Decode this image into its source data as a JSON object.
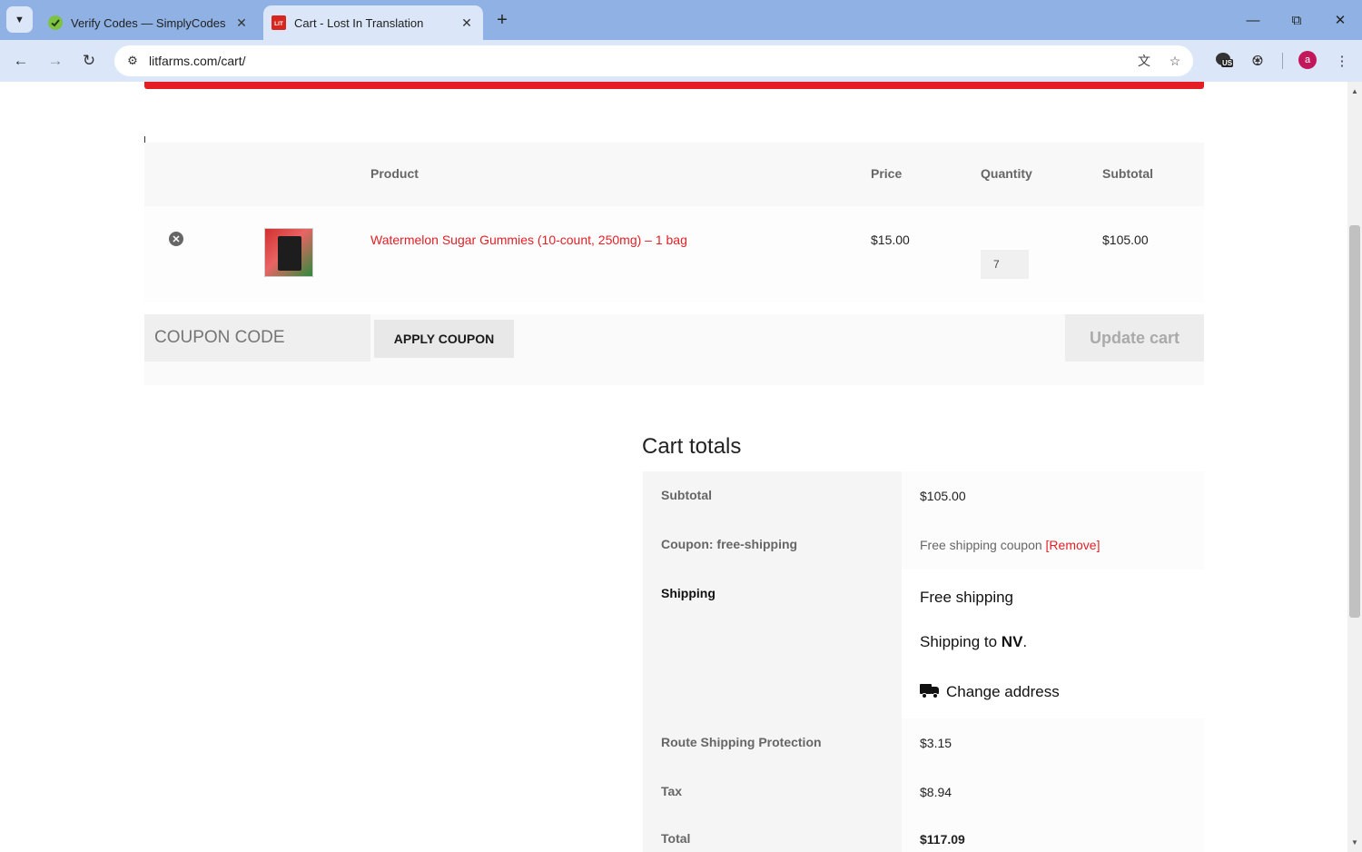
{
  "browser": {
    "tabs": [
      {
        "title": "Verify Codes — SimplyCodes",
        "favicon": "simplycodes-icon",
        "active": false
      },
      {
        "title": "Cart - Lost In Translation",
        "favicon": "litfarms-icon",
        "active": true
      }
    ],
    "favicon_text": "LIT",
    "url": "litfarms.com/cart/",
    "profile_initial": "a",
    "extension_badge": "US"
  },
  "cart": {
    "headers": {
      "product": "Product",
      "price": "Price",
      "quantity": "Quantity",
      "subtotal": "Subtotal"
    },
    "items": [
      {
        "name": "Watermelon Sugar Gummies (10-count, 250mg) – 1 bag",
        "price": "$15.00",
        "quantity": "7",
        "subtotal": "$105.00"
      }
    ],
    "coupon_placeholder": "COUPON CODE",
    "apply_label": "APPLY COUPON",
    "update_label": "Update cart"
  },
  "totals": {
    "title": "Cart totals",
    "subtotal_label": "Subtotal",
    "subtotal_value": "$105.00",
    "coupon_label": "Coupon: free-shipping",
    "coupon_value": "Free shipping coupon",
    "coupon_remove": "[Remove]",
    "shipping_label": "Shipping",
    "shipping_method": "Free shipping",
    "shipping_to_prefix": "Shipping to ",
    "shipping_state": "NV",
    "shipping_to_suffix": ".",
    "change_address": "Change address",
    "route_label": "Route Shipping Protection",
    "route_value": "$3.15",
    "tax_label": "Tax",
    "tax_value": "$8.94",
    "total_label": "Total",
    "total_value": "$117.09"
  },
  "colors": {
    "accent": "#e41e25",
    "chrome": "#8fb1e3",
    "toolbar": "#dbe6f8"
  }
}
